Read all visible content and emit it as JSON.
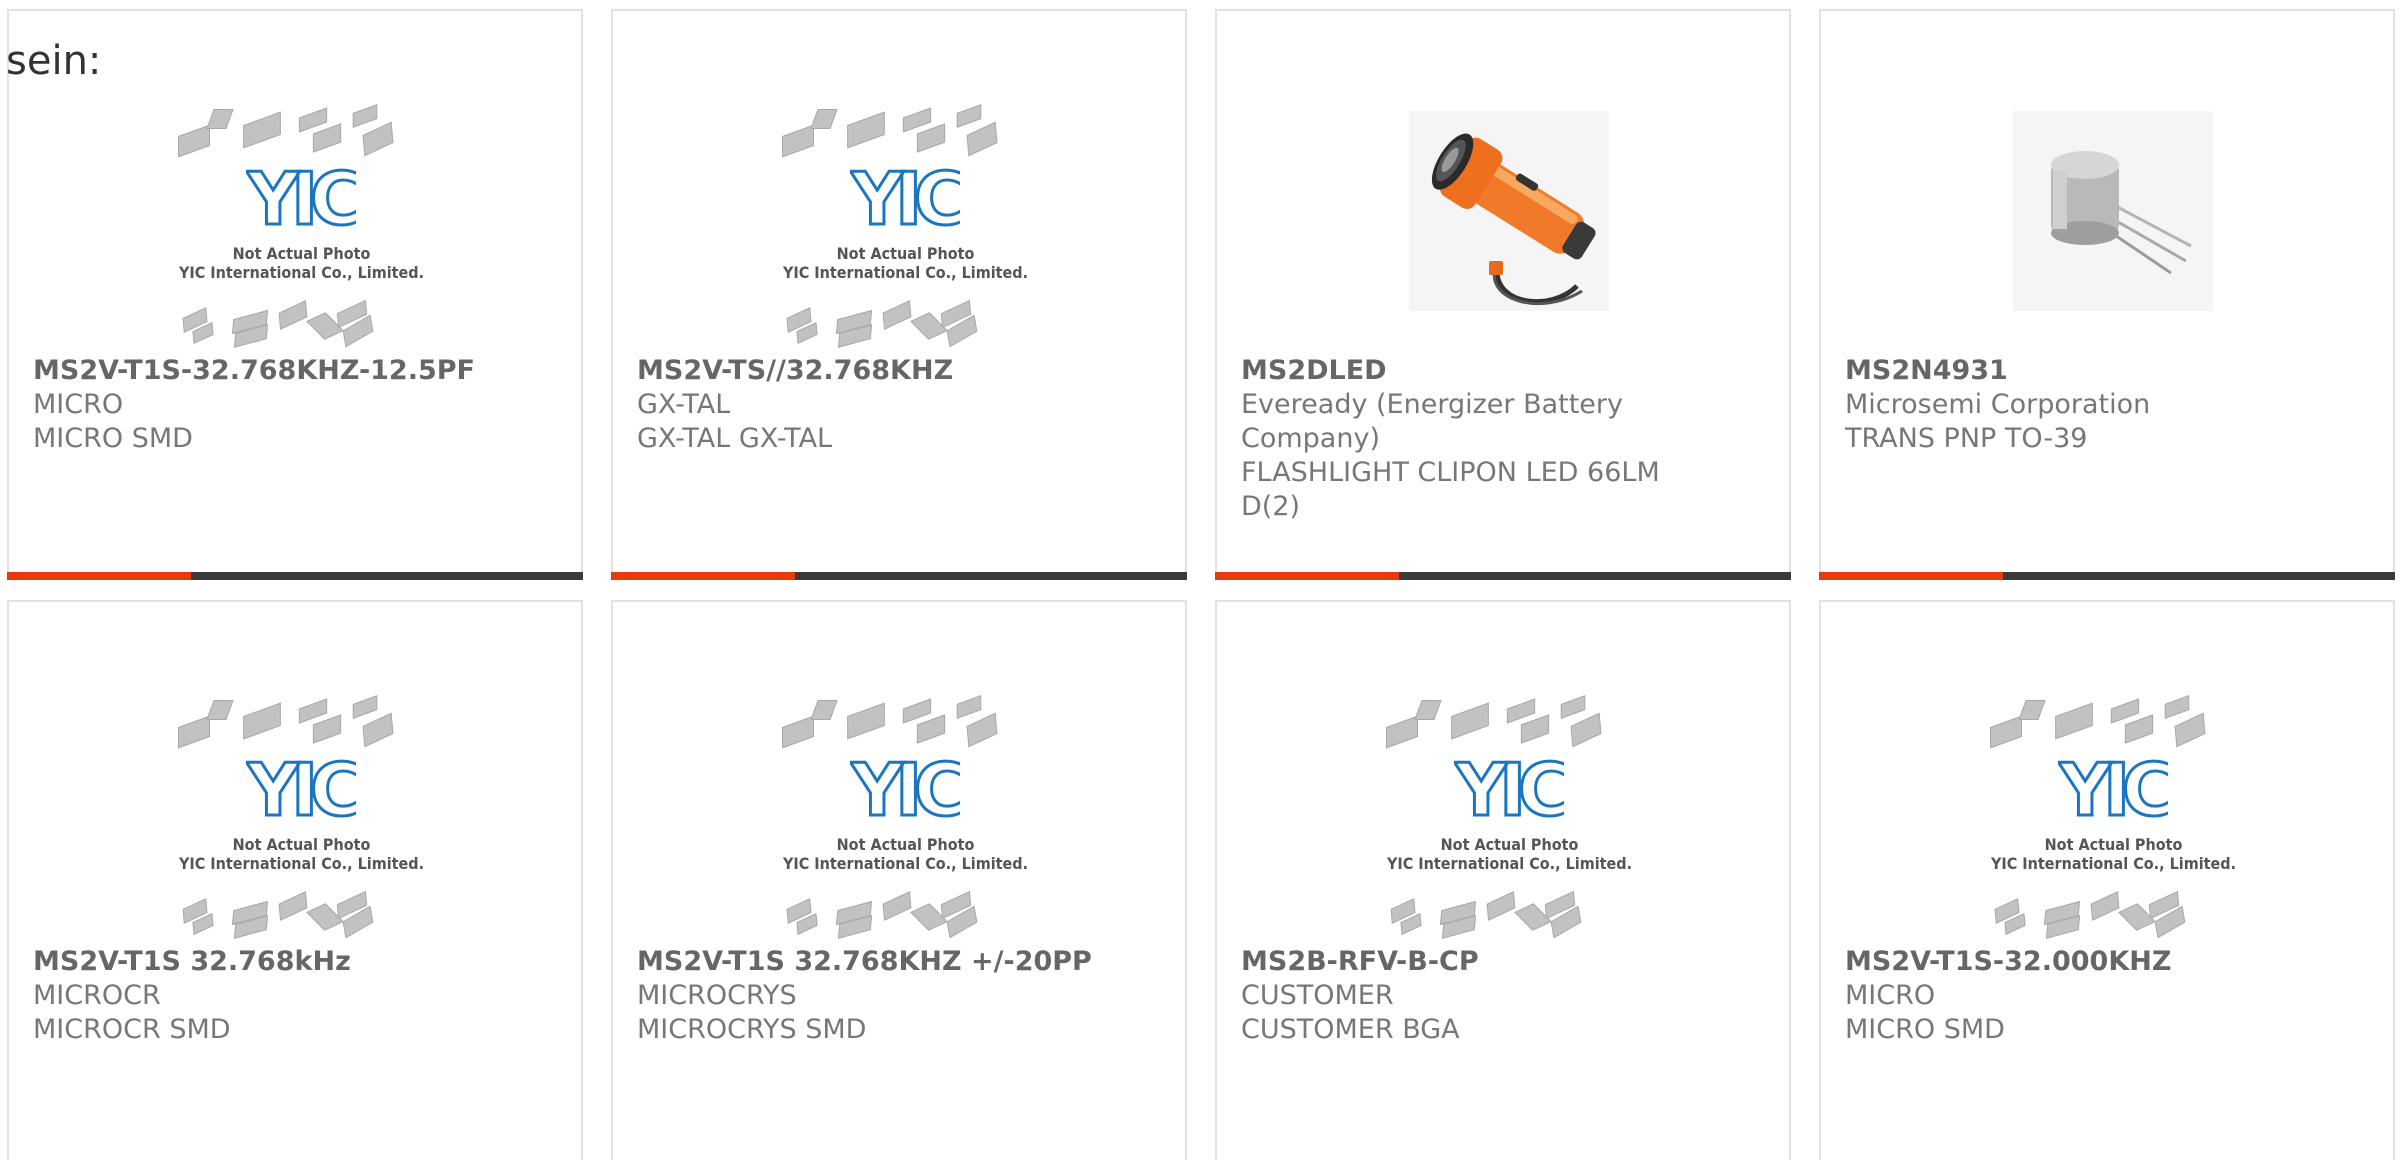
{
  "page": {
    "intro_text": "sein:"
  },
  "placeholder": {
    "line1": "Not Actual Photo",
    "line2": "YIC International Co., Limited.",
    "logo_text": "YIC"
  },
  "colors": {
    "accent": "#e8380d",
    "bar": "#3a3a3a",
    "logo": "#1c75c0",
    "border": "#e2e2e2"
  },
  "products": [
    {
      "part": "MS2V-T1S-32.768KHZ-12.5PF",
      "lines": [
        "MICRO",
        "MICRO SMD"
      ],
      "image": "placeholder"
    },
    {
      "part": "MS2V-TS//32.768KHZ",
      "lines": [
        "GX-TAL",
        "GX-TAL GX-TAL"
      ],
      "image": "placeholder"
    },
    {
      "part": "MS2DLED",
      "lines": [
        "Eveready (Energizer Battery",
        "Company)",
        "FLASHLIGHT CLIPON LED 66LM",
        "D(2)"
      ],
      "image": "flashlight-photo"
    },
    {
      "part": "MS2N4931",
      "lines": [
        "Microsemi Corporation",
        "TRANS PNP TO-39"
      ],
      "image": "transistor-photo"
    },
    {
      "part": "MS2V-T1S 32.768kHz",
      "lines": [
        "MICROCR",
        "MICROCR SMD"
      ],
      "image": "placeholder"
    },
    {
      "part": "MS2V-T1S 32.768KHZ +/-20PP",
      "lines": [
        "MICROCRYS",
        "MICROCRYS SMD"
      ],
      "image": "placeholder"
    },
    {
      "part": "MS2B-RFV-B-CP",
      "lines": [
        "CUSTOMER",
        "CUSTOMER BGA"
      ],
      "image": "placeholder"
    },
    {
      "part": "MS2V-T1S-32.000KHZ",
      "lines": [
        "MICRO",
        "MICRO SMD"
      ],
      "image": "placeholder"
    }
  ]
}
